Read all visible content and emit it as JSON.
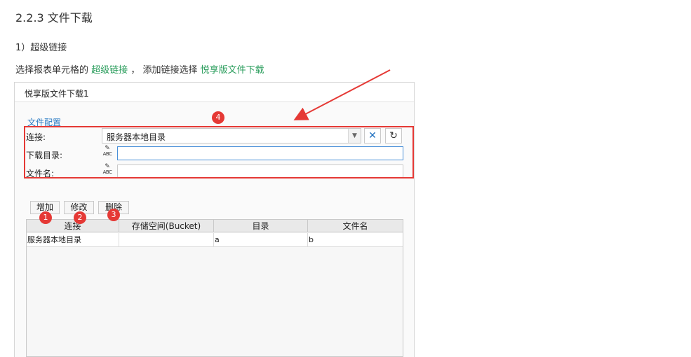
{
  "heading": "2.2.3 文件下载",
  "subheading": "1）超级链接",
  "description": {
    "prefix": "选择报表单元格的",
    "link1": "超级链接",
    "middle": "， 添加链接选择",
    "link2": "悦享版文件下载"
  },
  "dialog": {
    "title": "悦享版文件下载1",
    "section_label": "文件配置",
    "connection_label": "连接:",
    "connection_value": "服务器本地目录",
    "download_dir_label": "下载目录:",
    "filename_label": "文件名:",
    "formula_icon_text": "ABC"
  },
  "buttons": {
    "add": "增加",
    "edit": "修改",
    "delete": "删除"
  },
  "badges": [
    "1",
    "2",
    "3",
    "4"
  ],
  "table": {
    "columns": [
      "连接",
      "存储空间(Bucket)",
      "目录",
      "文件名"
    ],
    "rows": [
      [
        "服务器本地目录",
        "",
        "a",
        "b"
      ]
    ]
  },
  "colors": {
    "link": "#2a9d5c",
    "annotation": "#e53935",
    "section_label": "#2a7bc4"
  },
  "icons": {
    "dropdown": "chevron-down-icon",
    "tool": "tool-icon",
    "refresh": "refresh-icon",
    "formula": "formula-icon"
  }
}
